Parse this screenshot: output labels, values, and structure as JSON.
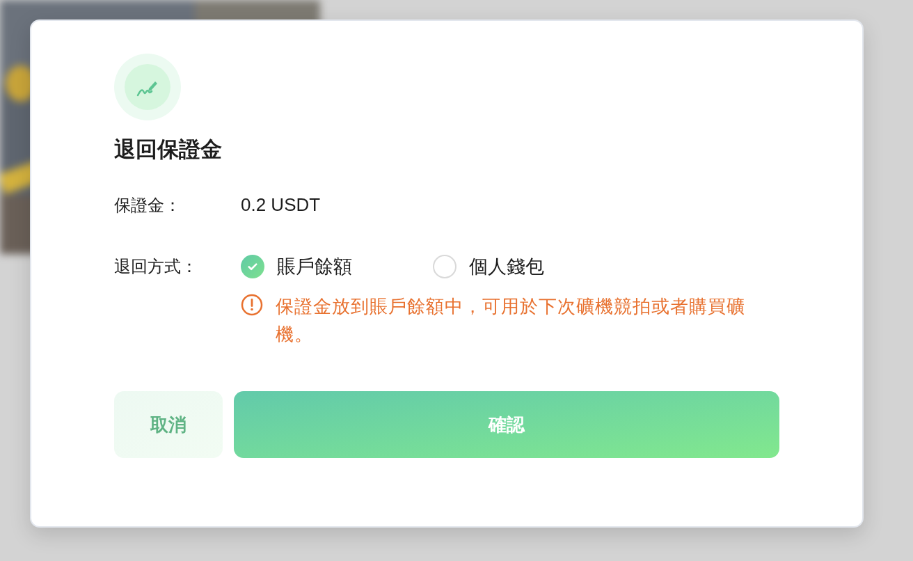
{
  "dialog": {
    "title": "退回保證金",
    "deposit": {
      "label": "保證金：",
      "value": "0.2 USDT"
    },
    "method": {
      "label": "退回方式：",
      "options": [
        {
          "label": "賬戶餘額",
          "selected": true
        },
        {
          "label": "個人錢包",
          "selected": false
        }
      ],
      "notice": "保證金放到賬戶餘額中，可用於下次礦機競拍或者購買礦機。"
    },
    "buttons": [
      {
        "label": "取消",
        "kind": "secondary"
      },
      {
        "label": "確認",
        "kind": "primary"
      }
    ]
  }
}
